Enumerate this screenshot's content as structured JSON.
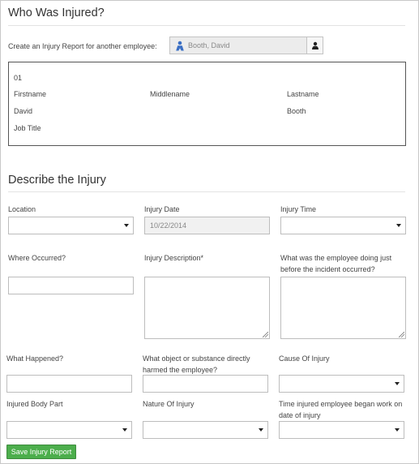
{
  "who": {
    "title": "Who Was Injured?",
    "create_label": "Create an Injury Report for another employee:",
    "employee_search_value": "Booth, David"
  },
  "employee_card": {
    "code": "01",
    "firstname_label": "Firstname",
    "middlename_label": "Middlename",
    "lastname_label": "Lastname",
    "firstname_value": "David",
    "middlename_value": "",
    "lastname_value": "Booth",
    "job_title_label": "Job Title",
    "job_title_value": ""
  },
  "describe": {
    "title": "Describe the Injury",
    "location_label": "Location",
    "location_value": "",
    "injury_date_label": "Injury Date",
    "injury_date_value": "10/22/2014",
    "injury_time_label": "Injury Time",
    "injury_time_value": "",
    "where_occurred_label": "Where Occurred?",
    "injury_description_label": "Injury Description*",
    "employee_doing_label": "What was the employee doing just before the incident occurred?",
    "what_happened_label": "What Happened?",
    "object_substance_label": "What object or substance directly harmed the employee?",
    "cause_label": "Cause Of Injury",
    "body_part_label": "Injured Body Part",
    "nature_label": "Nature Of Injury",
    "time_began_label": "Time injured employee began work on date of injury"
  },
  "actions": {
    "save_label": "Save Injury Report"
  },
  "colors": {
    "save_button": "#4cae4c",
    "employee_icon": "#3a6fc4"
  }
}
